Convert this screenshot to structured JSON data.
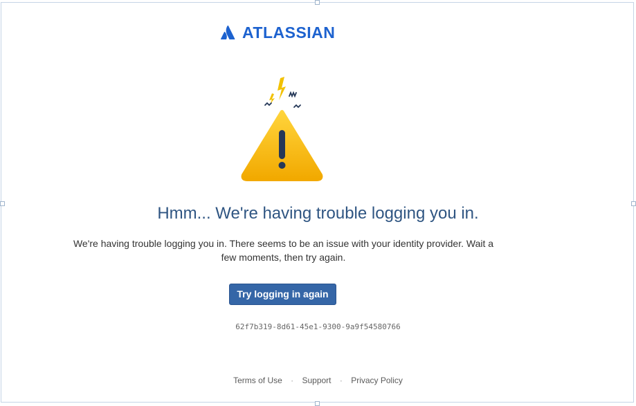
{
  "brand": {
    "name": "ATLASSIAN",
    "logo_icon": "atlassian-logo-icon",
    "color": "#1d62cf"
  },
  "illustration": {
    "icon": "warning-triangle-icon",
    "fill_top": "#ffd43b",
    "fill_bottom": "#f2a900",
    "accent": "#253858"
  },
  "error": {
    "heading": "Hmm... We're having trouble logging you in.",
    "message": "We're having trouble logging you in. There seems to be an issue with your identity provider. Wait a few moments, then try again.",
    "retry_label": "Try logging in again",
    "trace_id": "62f7b319-8d61-45e1-9300-9a9f54580766"
  },
  "footer": {
    "links": [
      "Terms of Use",
      "Support",
      "Privacy Policy"
    ],
    "separator": "·"
  },
  "colors": {
    "heading": "#2f5582",
    "button": "#3566a7"
  }
}
